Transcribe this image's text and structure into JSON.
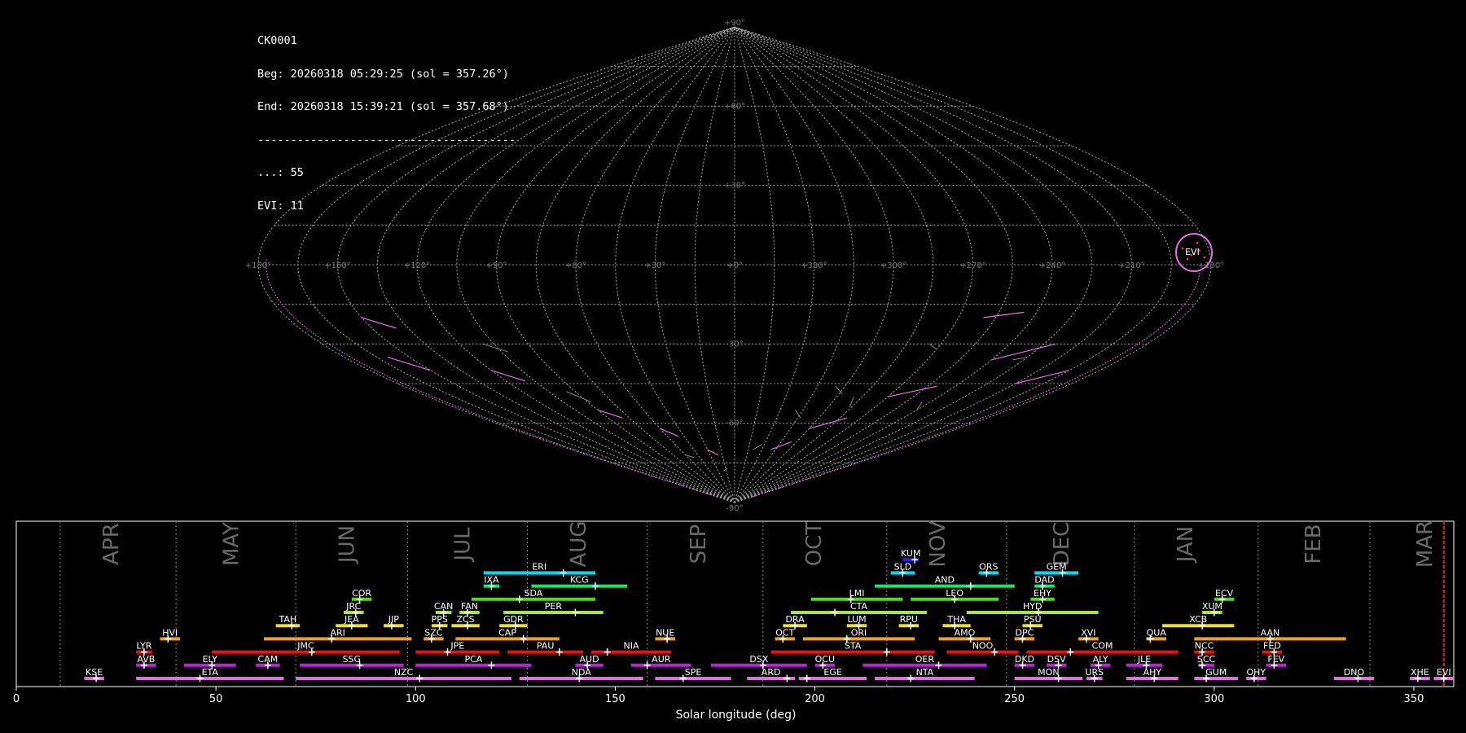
{
  "header": {
    "camera": "CK0001",
    "begin": "Beg: 20260318 05:29:25 (sol = 357.26°)",
    "end": "End: 20260318 15:39:21 (sol = 357.68°)",
    "separator": "---------------------------------------",
    "counts": [
      "...: 55",
      "EVI: 11"
    ]
  },
  "sky_map": {
    "projection": "sinusoidal-like all-sky",
    "lat_labels": [
      {
        "lat": 90,
        "text": "+90°"
      },
      {
        "lat": 60,
        "text": "+60°"
      },
      {
        "lat": 30,
        "text": "+30°"
      },
      {
        "lat": -30,
        "text": "-30°"
      },
      {
        "lat": -60,
        "text": "-60°"
      },
      {
        "lat": -90,
        "text": "-90°"
      }
    ],
    "lon_labels": [
      "+180°",
      "+150°",
      "+120°",
      "+90°",
      "+60°",
      "+30°",
      "+0°",
      "+330°",
      "+300°",
      "+270°",
      "+240°",
      "+210°",
      "+180°"
    ],
    "highlight_label": "EVI",
    "grid_color": "#9a9a9a",
    "track_color": "#e070e0",
    "highlight_color": "#ff3030"
  },
  "chart_data": {
    "type": "timeline",
    "xlabel": "Solar longitude (deg)",
    "xlim": [
      0,
      360
    ],
    "xticks": [
      0,
      50,
      100,
      150,
      200,
      250,
      300,
      350
    ],
    "month_labels": [
      {
        "text": "APR",
        "x": 24
      },
      {
        "text": "MAY",
        "x": 54
      },
      {
        "text": "JUN",
        "x": 83
      },
      {
        "text": "JUL",
        "x": 112
      },
      {
        "text": "AUG",
        "x": 141
      },
      {
        "text": "SEP",
        "x": 171
      },
      {
        "text": "OCT",
        "x": 200
      },
      {
        "text": "NOV",
        "x": 231
      },
      {
        "text": "DEC",
        "x": 262
      },
      {
        "text": "JAN",
        "x": 293
      },
      {
        "text": "FEB",
        "x": 325
      },
      {
        "text": "MAR",
        "x": 353
      }
    ],
    "month_dividers": [
      11,
      40,
      70,
      98,
      128,
      158,
      187,
      218,
      248,
      280,
      311,
      339
    ],
    "current_sol": 357.5,
    "rows": 10,
    "showers": [
      {
        "code": "KUM",
        "start": 222,
        "end": 226,
        "peak": 225,
        "row": 9,
        "color": "#2222ee"
      },
      {
        "code": "ERI",
        "start": 117,
        "end": 145,
        "peak": 137,
        "row": 8,
        "color": "#00d8f0"
      },
      {
        "code": "SLD",
        "start": 219,
        "end": 225,
        "peak": 222,
        "row": 8,
        "color": "#00d8f0"
      },
      {
        "code": "ORS",
        "start": 241,
        "end": 246,
        "peak": 243,
        "row": 8,
        "color": "#00d8f0"
      },
      {
        "code": "GEM",
        "start": 255,
        "end": 266,
        "peak": 262,
        "row": 8,
        "color": "#00d8f0"
      },
      {
        "code": "IXA",
        "start": 117,
        "end": 121,
        "peak": 119,
        "row": 7,
        "color": "#10e870"
      },
      {
        "code": "KCG",
        "start": 129,
        "end": 153,
        "peak": 145,
        "row": 7,
        "color": "#10e870"
      },
      {
        "code": "AND",
        "start": 215,
        "end": 250,
        "peak": 239,
        "row": 7,
        "color": "#10e870"
      },
      {
        "code": "DAD",
        "start": 255,
        "end": 260,
        "peak": 257,
        "row": 7,
        "color": "#10e870"
      },
      {
        "code": "COR",
        "start": 84,
        "end": 89,
        "peak": 86,
        "row": 6,
        "color": "#50d820"
      },
      {
        "code": "SDA",
        "start": 114,
        "end": 145,
        "peak": 126,
        "row": 6,
        "color": "#50d820"
      },
      {
        "code": "LMI",
        "start": 199,
        "end": 222,
        "peak": 209,
        "row": 6,
        "color": "#50d820"
      },
      {
        "code": "LEO",
        "start": 224,
        "end": 246,
        "peak": 235,
        "row": 6,
        "color": "#50d820"
      },
      {
        "code": "EHY",
        "start": 254,
        "end": 260,
        "peak": 257,
        "row": 6,
        "color": "#50d820"
      },
      {
        "code": "ECV",
        "start": 300,
        "end": 305,
        "peak": 302,
        "row": 6,
        "color": "#50d820"
      },
      {
        "code": "JRC",
        "start": 82,
        "end": 87,
        "peak": 85,
        "row": 5,
        "color": "#a8e830"
      },
      {
        "code": "CAN",
        "start": 105,
        "end": 109,
        "peak": 107,
        "row": 5,
        "color": "#a8e830"
      },
      {
        "code": "FAN",
        "start": 111,
        "end": 116,
        "peak": 113,
        "row": 5,
        "color": "#a8e830"
      },
      {
        "code": "PER",
        "start": 122,
        "end": 147,
        "peak": 140,
        "row": 5,
        "color": "#a8e830"
      },
      {
        "code": "CTA",
        "start": 194,
        "end": 228,
        "peak": 205,
        "row": 5,
        "color": "#a8e830"
      },
      {
        "code": "HYD",
        "start": 238,
        "end": 271,
        "peak": 256,
        "row": 5,
        "color": "#a8e830"
      },
      {
        "code": "XUM",
        "start": 297,
        "end": 302,
        "peak": 300,
        "row": 5,
        "color": "#a8e830"
      },
      {
        "code": "TAH",
        "start": 65,
        "end": 71,
        "peak": 69,
        "row": 4,
        "color": "#f0e020"
      },
      {
        "code": "JEA",
        "start": 80,
        "end": 88,
        "peak": 84,
        "row": 4,
        "color": "#f0e020"
      },
      {
        "code": "JIP",
        "start": 92,
        "end": 97,
        "peak": 94,
        "row": 4,
        "color": "#f0e020"
      },
      {
        "code": "PPS",
        "start": 104,
        "end": 108,
        "peak": 106,
        "row": 4,
        "color": "#f0e020"
      },
      {
        "code": "ZCS",
        "start": 109,
        "end": 116,
        "peak": 113,
        "row": 4,
        "color": "#f0e020"
      },
      {
        "code": "GDR",
        "start": 121,
        "end": 128,
        "peak": 125,
        "row": 4,
        "color": "#f0e020"
      },
      {
        "code": "DRA",
        "start": 192,
        "end": 198,
        "peak": 195,
        "row": 4,
        "color": "#f0e020"
      },
      {
        "code": "LUM",
        "start": 208,
        "end": 213,
        "peak": 211,
        "row": 4,
        "color": "#f0e020"
      },
      {
        "code": "RPU",
        "start": 221,
        "end": 226,
        "peak": 224,
        "row": 4,
        "color": "#f0e020"
      },
      {
        "code": "THA",
        "start": 232,
        "end": 239,
        "peak": 235,
        "row": 4,
        "color": "#f0e020"
      },
      {
        "code": "PSU",
        "start": 252,
        "end": 257,
        "peak": 254,
        "row": 4,
        "color": "#f0e020"
      },
      {
        "code": "XCB",
        "start": 287,
        "end": 305,
        "peak": 297,
        "row": 4,
        "color": "#f0e020"
      },
      {
        "code": "HVI",
        "start": 36,
        "end": 41,
        "peak": 38,
        "row": 3,
        "color": "#f0a020"
      },
      {
        "code": "ARI",
        "start": 62,
        "end": 99,
        "peak": 79,
        "row": 3,
        "color": "#f0a020"
      },
      {
        "code": "SZC",
        "start": 102,
        "end": 107,
        "peak": 104,
        "row": 3,
        "color": "#f0a020"
      },
      {
        "code": "CAP",
        "start": 110,
        "end": 136,
        "peak": 127,
        "row": 3,
        "color": "#f0a020"
      },
      {
        "code": "NUE",
        "start": 160,
        "end": 165,
        "peak": 163,
        "row": 3,
        "color": "#f0a020"
      },
      {
        "code": "OCT",
        "start": 190,
        "end": 195,
        "peak": 192,
        "row": 3,
        "color": "#f0a020"
      },
      {
        "code": "ORI",
        "start": 197,
        "end": 225,
        "peak": 208,
        "row": 3,
        "color": "#f0a020"
      },
      {
        "code": "AMO",
        "start": 231,
        "end": 244,
        "peak": 239,
        "row": 3,
        "color": "#f0a020"
      },
      {
        "code": "DPC",
        "start": 250,
        "end": 255,
        "peak": 252,
        "row": 3,
        "color": "#f0a020"
      },
      {
        "code": "XVI",
        "start": 266,
        "end": 271,
        "peak": 268,
        "row": 3,
        "color": "#f0a020"
      },
      {
        "code": "QUA",
        "start": 283,
        "end": 288,
        "peak": 284,
        "row": 3,
        "color": "#f0a020"
      },
      {
        "code": "AAN",
        "start": 295,
        "end": 333,
        "peak": 314,
        "row": 3,
        "color": "#f0a020"
      },
      {
        "code": "LYR",
        "start": 30,
        "end": 34,
        "peak": 32,
        "row": 2,
        "color": "#f01010"
      },
      {
        "code": "JMC",
        "start": 49,
        "end": 96,
        "peak": 74,
        "row": 2,
        "color": "#f01010"
      },
      {
        "code": "JPE",
        "start": 100,
        "end": 121,
        "peak": 108,
        "row": 2,
        "color": "#f01010"
      },
      {
        "code": "PAU",
        "start": 123,
        "end": 142,
        "peak": 136,
        "row": 2,
        "color": "#f01010"
      },
      {
        "code": "NIA",
        "start": 144,
        "end": 164,
        "peak": 148,
        "row": 2,
        "color": "#f01010"
      },
      {
        "code": "STA",
        "start": 189,
        "end": 230,
        "peak": 218,
        "row": 2,
        "color": "#f01010"
      },
      {
        "code": "NOO",
        "start": 233,
        "end": 251,
        "peak": 245,
        "row": 2,
        "color": "#f01010"
      },
      {
        "code": "COM",
        "start": 253,
        "end": 291,
        "peak": 264,
        "row": 2,
        "color": "#f01010"
      },
      {
        "code": "NCC",
        "start": 295,
        "end": 300,
        "peak": 297,
        "row": 2,
        "color": "#f01010"
      },
      {
        "code": "FED",
        "start": 312,
        "end": 317,
        "peak": 315,
        "row": 2,
        "color": "#f01010"
      },
      {
        "code": "AVB",
        "start": 30,
        "end": 35,
        "peak": 32,
        "row": 1,
        "color": "#c020e0"
      },
      {
        "code": "ELY",
        "start": 42,
        "end": 55,
        "peak": 49,
        "row": 1,
        "color": "#c020e0"
      },
      {
        "code": "CAM",
        "start": 60,
        "end": 66,
        "peak": 63,
        "row": 1,
        "color": "#c020e0"
      },
      {
        "code": "SSG",
        "start": 71,
        "end": 97,
        "peak": 86,
        "row": 1,
        "color": "#c020e0"
      },
      {
        "code": "PCA",
        "start": 100,
        "end": 129,
        "peak": 119,
        "row": 1,
        "color": "#c020e0"
      },
      {
        "code": "AUD",
        "start": 140,
        "end": 147,
        "peak": 143,
        "row": 1,
        "color": "#c020e0"
      },
      {
        "code": "AUR",
        "start": 154,
        "end": 169,
        "peak": 158,
        "row": 1,
        "color": "#c020e0"
      },
      {
        "code": "DSX",
        "start": 174,
        "end": 198,
        "peak": 187,
        "row": 1,
        "color": "#c020e0"
      },
      {
        "code": "OCU",
        "start": 200,
        "end": 205,
        "peak": 202,
        "row": 1,
        "color": "#c020e0"
      },
      {
        "code": "OER",
        "start": 212,
        "end": 243,
        "peak": 231,
        "row": 1,
        "color": "#c020e0"
      },
      {
        "code": "DKD",
        "start": 250,
        "end": 255,
        "peak": 252,
        "row": 1,
        "color": "#c020e0"
      },
      {
        "code": "DSV",
        "start": 258,
        "end": 263,
        "peak": 261,
        "row": 1,
        "color": "#c020e0"
      },
      {
        "code": "ALY",
        "start": 269,
        "end": 274,
        "peak": 271,
        "row": 1,
        "color": "#c020e0"
      },
      {
        "code": "JLE",
        "start": 278,
        "end": 287,
        "peak": 283,
        "row": 1,
        "color": "#c020e0"
      },
      {
        "code": "SCC",
        "start": 296,
        "end": 300,
        "peak": 297,
        "row": 1,
        "color": "#c020e0"
      },
      {
        "code": "FEV",
        "start": 313,
        "end": 318,
        "peak": 315,
        "row": 1,
        "color": "#c020e0"
      },
      {
        "code": "KSE",
        "start": 17,
        "end": 22,
        "peak": 20,
        "row": 0,
        "color": "#e070e0"
      },
      {
        "code": "ETA",
        "start": 30,
        "end": 67,
        "peak": 46,
        "row": 0,
        "color": "#e070e0"
      },
      {
        "code": "NZC",
        "start": 70,
        "end": 124,
        "peak": 101,
        "row": 0,
        "color": "#e070e0"
      },
      {
        "code": "NDA",
        "start": 126,
        "end": 157,
        "peak": 141,
        "row": 0,
        "color": "#e070e0"
      },
      {
        "code": "SPE",
        "start": 160,
        "end": 179,
        "peak": 167,
        "row": 0,
        "color": "#e070e0"
      },
      {
        "code": "ARD",
        "start": 183,
        "end": 195,
        "peak": 193,
        "row": 0,
        "color": "#e070e0"
      },
      {
        "code": "EGE",
        "start": 196,
        "end": 213,
        "peak": 198,
        "row": 0,
        "color": "#e070e0"
      },
      {
        "code": "NTA",
        "start": 215,
        "end": 240,
        "peak": 224,
        "row": 0,
        "color": "#e070e0"
      },
      {
        "code": "MON",
        "start": 250,
        "end": 267,
        "peak": 261,
        "row": 0,
        "color": "#e070e0"
      },
      {
        "code": "URS",
        "start": 268,
        "end": 272,
        "peak": 270,
        "row": 0,
        "color": "#e070e0"
      },
      {
        "code": "AHY",
        "start": 278,
        "end": 291,
        "peak": 285,
        "row": 0,
        "color": "#e070e0"
      },
      {
        "code": "GUM",
        "start": 295,
        "end": 306,
        "peak": 298,
        "row": 0,
        "color": "#e070e0"
      },
      {
        "code": "OHY",
        "start": 308,
        "end": 313,
        "peak": 310,
        "row": 0,
        "color": "#e070e0"
      },
      {
        "code": "DNO",
        "start": 330,
        "end": 340,
        "peak": 336,
        "row": 0,
        "color": "#e070e0"
      },
      {
        "code": "XHE",
        "start": 349,
        "end": 354,
        "peak": 351,
        "row": 0,
        "color": "#e070e0"
      },
      {
        "code": "EVI",
        "start": 355,
        "end": 360,
        "peak": 357.5,
        "row": 0,
        "color": "#e070e0"
      }
    ]
  }
}
